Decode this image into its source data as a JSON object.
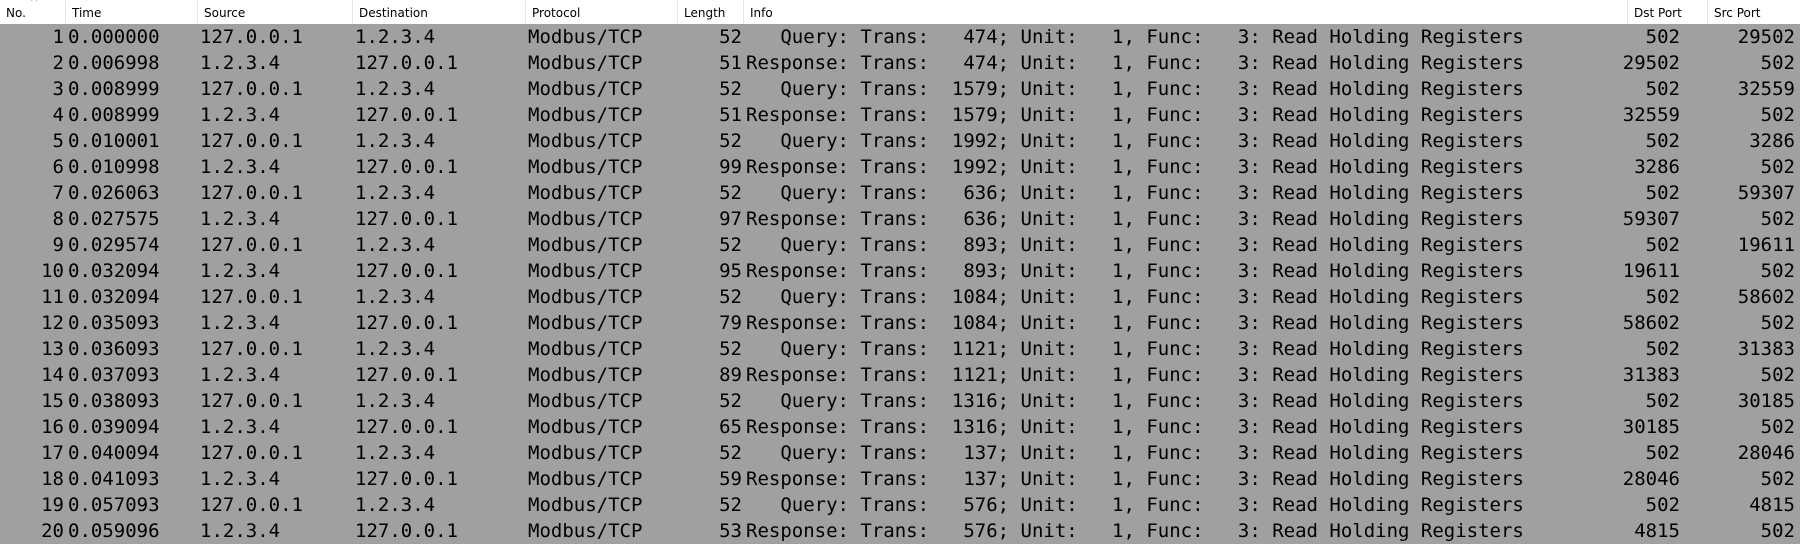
{
  "columns": {
    "no": "No.",
    "time": "Time",
    "source": "Source",
    "destination": "Destination",
    "protocol": "Protocol",
    "length": "Length",
    "info": "Info",
    "dst_port": "Dst Port",
    "src_port": "Src Port"
  },
  "sort_indicator": "^",
  "colors": {
    "row_background": "#a0a0a0",
    "header_background": "#ffffff"
  },
  "packets": [
    {
      "no": "1",
      "time": "0.000000",
      "source": "127.0.0.1",
      "destination": "1.2.3.4",
      "protocol": "Modbus/TCP",
      "length": "52",
      "info": "   Query: Trans:   474; Unit:   1, Func:   3: Read Holding Registers",
      "dst_port": "502",
      "src_port": "29502"
    },
    {
      "no": "2",
      "time": "0.006998",
      "source": "1.2.3.4",
      "destination": "127.0.0.1",
      "protocol": "Modbus/TCP",
      "length": "51",
      "info": "Response: Trans:   474; Unit:   1, Func:   3: Read Holding Registers",
      "dst_port": "29502",
      "src_port": "502"
    },
    {
      "no": "3",
      "time": "0.008999",
      "source": "127.0.0.1",
      "destination": "1.2.3.4",
      "protocol": "Modbus/TCP",
      "length": "52",
      "info": "   Query: Trans:  1579; Unit:   1, Func:   3: Read Holding Registers",
      "dst_port": "502",
      "src_port": "32559"
    },
    {
      "no": "4",
      "time": "0.008999",
      "source": "1.2.3.4",
      "destination": "127.0.0.1",
      "protocol": "Modbus/TCP",
      "length": "51",
      "info": "Response: Trans:  1579; Unit:   1, Func:   3: Read Holding Registers",
      "dst_port": "32559",
      "src_port": "502"
    },
    {
      "no": "5",
      "time": "0.010001",
      "source": "127.0.0.1",
      "destination": "1.2.3.4",
      "protocol": "Modbus/TCP",
      "length": "52",
      "info": "   Query: Trans:  1992; Unit:   1, Func:   3: Read Holding Registers",
      "dst_port": "502",
      "src_port": "3286"
    },
    {
      "no": "6",
      "time": "0.010998",
      "source": "1.2.3.4",
      "destination": "127.0.0.1",
      "protocol": "Modbus/TCP",
      "length": "99",
      "info": "Response: Trans:  1992; Unit:   1, Func:   3: Read Holding Registers",
      "dst_port": "3286",
      "src_port": "502"
    },
    {
      "no": "7",
      "time": "0.026063",
      "source": "127.0.0.1",
      "destination": "1.2.3.4",
      "protocol": "Modbus/TCP",
      "length": "52",
      "info": "   Query: Trans:   636; Unit:   1, Func:   3: Read Holding Registers",
      "dst_port": "502",
      "src_port": "59307"
    },
    {
      "no": "8",
      "time": "0.027575",
      "source": "1.2.3.4",
      "destination": "127.0.0.1",
      "protocol": "Modbus/TCP",
      "length": "97",
      "info": "Response: Trans:   636; Unit:   1, Func:   3: Read Holding Registers",
      "dst_port": "59307",
      "src_port": "502"
    },
    {
      "no": "9",
      "time": "0.029574",
      "source": "127.0.0.1",
      "destination": "1.2.3.4",
      "protocol": "Modbus/TCP",
      "length": "52",
      "info": "   Query: Trans:   893; Unit:   1, Func:   3: Read Holding Registers",
      "dst_port": "502",
      "src_port": "19611"
    },
    {
      "no": "10",
      "time": "0.032094",
      "source": "1.2.3.4",
      "destination": "127.0.0.1",
      "protocol": "Modbus/TCP",
      "length": "95",
      "info": "Response: Trans:   893; Unit:   1, Func:   3: Read Holding Registers",
      "dst_port": "19611",
      "src_port": "502"
    },
    {
      "no": "11",
      "time": "0.032094",
      "source": "127.0.0.1",
      "destination": "1.2.3.4",
      "protocol": "Modbus/TCP",
      "length": "52",
      "info": "   Query: Trans:  1084; Unit:   1, Func:   3: Read Holding Registers",
      "dst_port": "502",
      "src_port": "58602"
    },
    {
      "no": "12",
      "time": "0.035093",
      "source": "1.2.3.4",
      "destination": "127.0.0.1",
      "protocol": "Modbus/TCP",
      "length": "79",
      "info": "Response: Trans:  1084; Unit:   1, Func:   3: Read Holding Registers",
      "dst_port": "58602",
      "src_port": "502"
    },
    {
      "no": "13",
      "time": "0.036093",
      "source": "127.0.0.1",
      "destination": "1.2.3.4",
      "protocol": "Modbus/TCP",
      "length": "52",
      "info": "   Query: Trans:  1121; Unit:   1, Func:   3: Read Holding Registers",
      "dst_port": "502",
      "src_port": "31383"
    },
    {
      "no": "14",
      "time": "0.037093",
      "source": "1.2.3.4",
      "destination": "127.0.0.1",
      "protocol": "Modbus/TCP",
      "length": "89",
      "info": "Response: Trans:  1121; Unit:   1, Func:   3: Read Holding Registers",
      "dst_port": "31383",
      "src_port": "502"
    },
    {
      "no": "15",
      "time": "0.038093",
      "source": "127.0.0.1",
      "destination": "1.2.3.4",
      "protocol": "Modbus/TCP",
      "length": "52",
      "info": "   Query: Trans:  1316; Unit:   1, Func:   3: Read Holding Registers",
      "dst_port": "502",
      "src_port": "30185"
    },
    {
      "no": "16",
      "time": "0.039094",
      "source": "1.2.3.4",
      "destination": "127.0.0.1",
      "protocol": "Modbus/TCP",
      "length": "65",
      "info": "Response: Trans:  1316; Unit:   1, Func:   3: Read Holding Registers",
      "dst_port": "30185",
      "src_port": "502"
    },
    {
      "no": "17",
      "time": "0.040094",
      "source": "127.0.0.1",
      "destination": "1.2.3.4",
      "protocol": "Modbus/TCP",
      "length": "52",
      "info": "   Query: Trans:   137; Unit:   1, Func:   3: Read Holding Registers",
      "dst_port": "502",
      "src_port": "28046"
    },
    {
      "no": "18",
      "time": "0.041093",
      "source": "1.2.3.4",
      "destination": "127.0.0.1",
      "protocol": "Modbus/TCP",
      "length": "59",
      "info": "Response: Trans:   137; Unit:   1, Func:   3: Read Holding Registers",
      "dst_port": "28046",
      "src_port": "502"
    },
    {
      "no": "19",
      "time": "0.057093",
      "source": "127.0.0.1",
      "destination": "1.2.3.4",
      "protocol": "Modbus/TCP",
      "length": "52",
      "info": "   Query: Trans:   576; Unit:   1, Func:   3: Read Holding Registers",
      "dst_port": "502",
      "src_port": "4815"
    },
    {
      "no": "20",
      "time": "0.059096",
      "source": "1.2.3.4",
      "destination": "127.0.0.1",
      "protocol": "Modbus/TCP",
      "length": "53",
      "info": "Response: Trans:   576; Unit:   1, Func:   3: Read Holding Registers",
      "dst_port": "4815",
      "src_port": "502"
    }
  ]
}
